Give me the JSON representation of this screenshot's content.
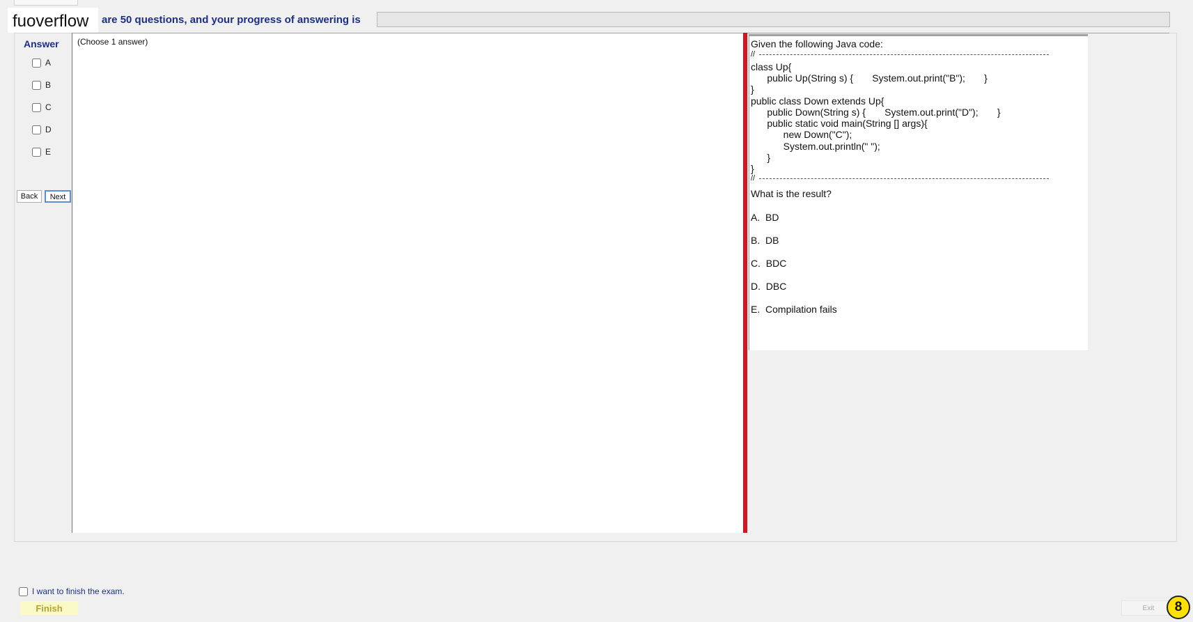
{
  "header": {
    "brand": "fuoverflow",
    "progress_text": "are 50 questions, and your progress of answering is",
    "progress_value": 0
  },
  "answer_panel": {
    "title": "Answer",
    "options": [
      "A",
      "B",
      "C",
      "D",
      "E"
    ],
    "back_label": "Back",
    "next_label": "Next"
  },
  "left_pane": {
    "instruction": "(Choose 1 answer)"
  },
  "question": {
    "intro": "Given the following Java code:",
    "separator": "//",
    "code_lines": [
      "class Up{",
      "      public Up(String s) {       System.out.print(\"B\");       }",
      "}",
      "public class Down extends Up{",
      "      public Down(String s) {       System.out.print(\"D\");       }",
      "      public static void main(String [] args){",
      "            new Down(\"C\");",
      "            System.out.println(\" \");",
      "      }",
      "}"
    ],
    "prompt": "What is the result?",
    "choices": [
      "A.  BD",
      "B.  DB",
      "C.  BDC",
      "D.  DBC",
      "E.  Compilation fails"
    ]
  },
  "footer": {
    "finish_checkbox_label": "I want to finish the exam.",
    "finish_label": "Finish",
    "exit_label": "Exit",
    "badge": "8"
  },
  "colors": {
    "label_blue": "#1a2f8c",
    "splitter_red": "#d4141f",
    "badge_yellow": "#ffe100",
    "finish_bg": "#fafac8"
  }
}
